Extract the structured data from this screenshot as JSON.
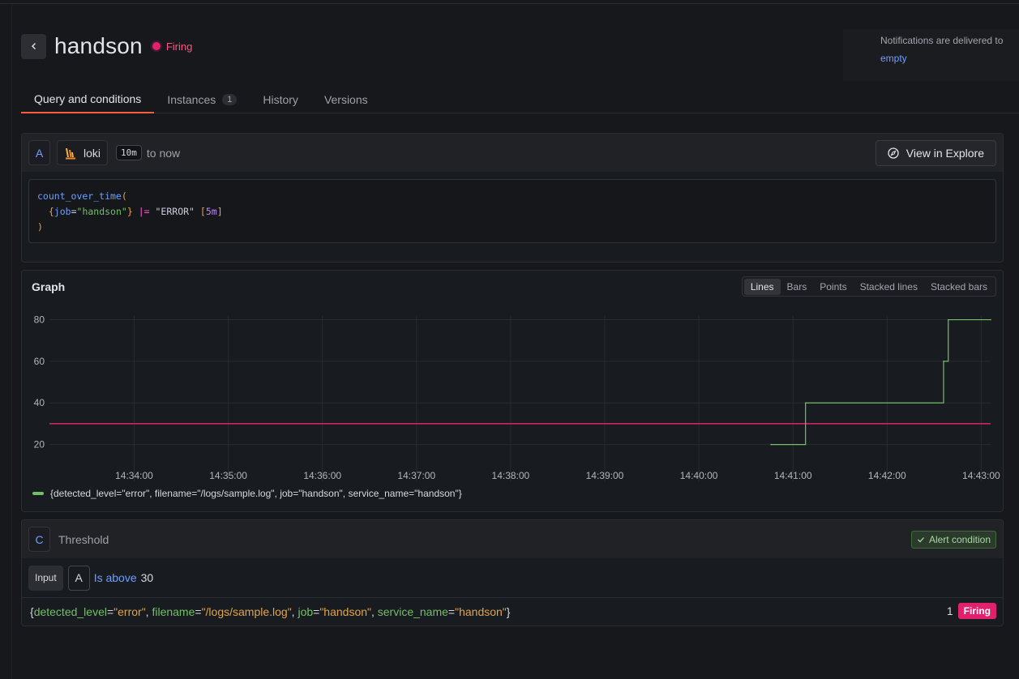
{
  "rule": {
    "title": "handson",
    "state": "Firing"
  },
  "notifications": {
    "text": "Notifications are delivered to",
    "link": "empty"
  },
  "tabs": [
    {
      "label": "Query and conditions",
      "active": true
    },
    {
      "label": "Instances",
      "count": "1"
    },
    {
      "label": "History"
    },
    {
      "label": "Versions"
    }
  ],
  "query": {
    "ref_id": "A",
    "datasource": "loki",
    "range": "10m",
    "range_suffix": "to now",
    "explore_label": "View in Explore",
    "expr": {
      "fn": "count_over_time",
      "open": "(",
      "label_key": "job",
      "label_value": "\"handson\"",
      "op": "|=",
      "filter": "\"ERROR\"",
      "window": "5m",
      "close": ")"
    }
  },
  "graph": {
    "title": "Graph",
    "modes": [
      "Lines",
      "Bars",
      "Points",
      "Stacked lines",
      "Stacked bars"
    ],
    "active_mode": "Lines"
  },
  "chart_data": {
    "type": "line",
    "x_unit": "time",
    "xlim": [
      "14:33:06",
      "14:43:06"
    ],
    "ylim": [
      14,
      88
    ],
    "yticks": [
      20,
      40,
      60,
      80
    ],
    "xticks": [
      "14:34:00",
      "14:35:00",
      "14:36:00",
      "14:37:00",
      "14:38:00",
      "14:39:00",
      "14:40:00",
      "14:41:00",
      "14:42:00",
      "14:43:00"
    ],
    "grid": true,
    "legend_position": "bottom-left",
    "series": [
      {
        "name": "{detected_level=\"error\", filename=\"/logs/sample.log\", job=\"handson\", service_name=\"handson\"}",
        "color": "#73bf69",
        "step": true,
        "points": [
          [
            "14:40:46",
            20
          ],
          [
            "14:41:08",
            40
          ],
          [
            "14:42:36",
            60
          ],
          [
            "14:42:39",
            80
          ],
          [
            "14:43:06",
            80
          ]
        ]
      }
    ],
    "threshold": {
      "value": 30,
      "color": "#e0226e"
    }
  },
  "threshold": {
    "ref_id": "C",
    "label": "Threshold",
    "alert_condition": "Alert condition",
    "input_label": "Input",
    "input_ref": "A",
    "condition": "Is above",
    "value": "30",
    "result": {
      "labels": [
        {
          "key": "detected_level",
          "value": "\"error\""
        },
        {
          "key": "filename",
          "value": "\"/logs/sample.log\""
        },
        {
          "key": "job",
          "value": "\"handson\""
        },
        {
          "key": "service_name",
          "value": "\"handson\""
        }
      ],
      "count": "1",
      "state": "Firing"
    }
  }
}
